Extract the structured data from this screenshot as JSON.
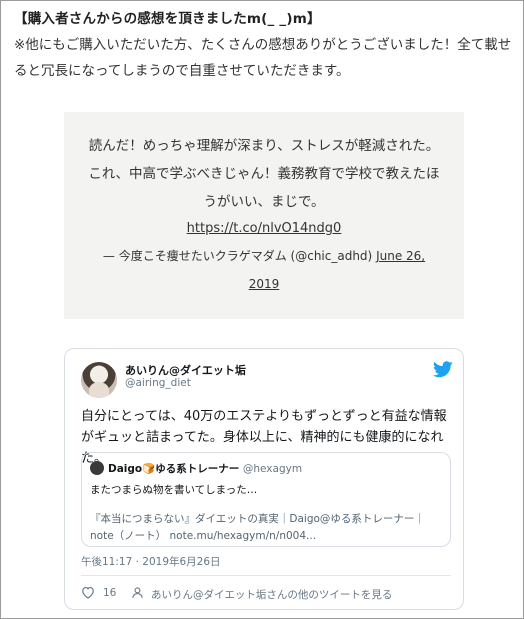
{
  "article": {
    "heading": "【購入者さんからの感想を頂きましたm(_ _)m】",
    "intro": "※他にもご購入いただいた方、たくさんの感想ありがとうございました！全て載せると冗長になってしまうので自重させていただきます。"
  },
  "blockquote": {
    "text": "読んだ！めっちゃ理解が深まり、ストレスが軽減された。これ、中高で学ぶべきじゃん！義務教育で学校で教えたほうがいい、まじで。",
    "link": "https://t.co/nlvO14ndg0",
    "attribution_prefix": "— 今度こそ痩せたいクラゲマダム (@chic_adhd)",
    "date": "June 26, 2019"
  },
  "tweet": {
    "display_name": "あいりん@ダイエット垢",
    "handle": "@airing_diet",
    "body": "自分にとっては、40万のエステよりもずっとずっと有益な情報がギュッと詰まってた。身体以上に、精神的にも健康的になれた。",
    "embed": {
      "name": "Daigo🍞ゆる系トレーナー",
      "handle": "@hexagym",
      "text": "またつまらぬ物を書いてしまった…",
      "card": "『本当につまらない』ダイエットの真実｜Daigo@ゆる系トレーナー｜note（ノート） note.mu/hexagym/n/n004..."
    },
    "timestamp": "午後11:17 · 2019年6月26日",
    "like_count": "16",
    "more_link": "あいりん@ダイエット垢さんの他のツイートを見る",
    "icons": {
      "avatar": "avatar-image",
      "bird": "twitter-bird-icon",
      "heart": "heart-icon",
      "profile": "profile-icon"
    },
    "colors": {
      "bird": "#1da1f2",
      "muted": "#657786",
      "border": "#d7dde2"
    }
  }
}
